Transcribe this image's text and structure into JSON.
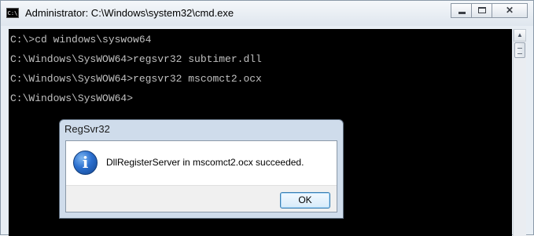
{
  "window": {
    "title": "Administrator: C:\\Windows\\system32\\cmd.exe",
    "icon": "cmd-icon",
    "icon_text": "C:\\",
    "caption_buttons": {
      "minimize": "minimize-icon",
      "maximize": "maximize-icon",
      "close": "close-icon",
      "close_glyph": "✕"
    }
  },
  "console": {
    "lines": [
      "C:\\>cd windows\\syswow64",
      "C:\\Windows\\SysWOW64>regsvr32 subtimer.dll",
      "C:\\Windows\\SysWOW64>regsvr32 mscomct2.ocx",
      "C:\\Windows\\SysWOW64>"
    ]
  },
  "scrollbar": {
    "up_glyph": "▲",
    "position": 0
  },
  "dialog": {
    "title": "RegSvr32",
    "icon": "info-icon",
    "icon_glyph": "i",
    "message": "DllRegisterServer in mscomct2.ocx succeeded.",
    "ok_label": "OK"
  },
  "colors": {
    "console_bg": "#000000",
    "console_text": "#c0c0c0",
    "dialog_frame": "#cfdceb",
    "ok_border": "#3c7fb1"
  }
}
